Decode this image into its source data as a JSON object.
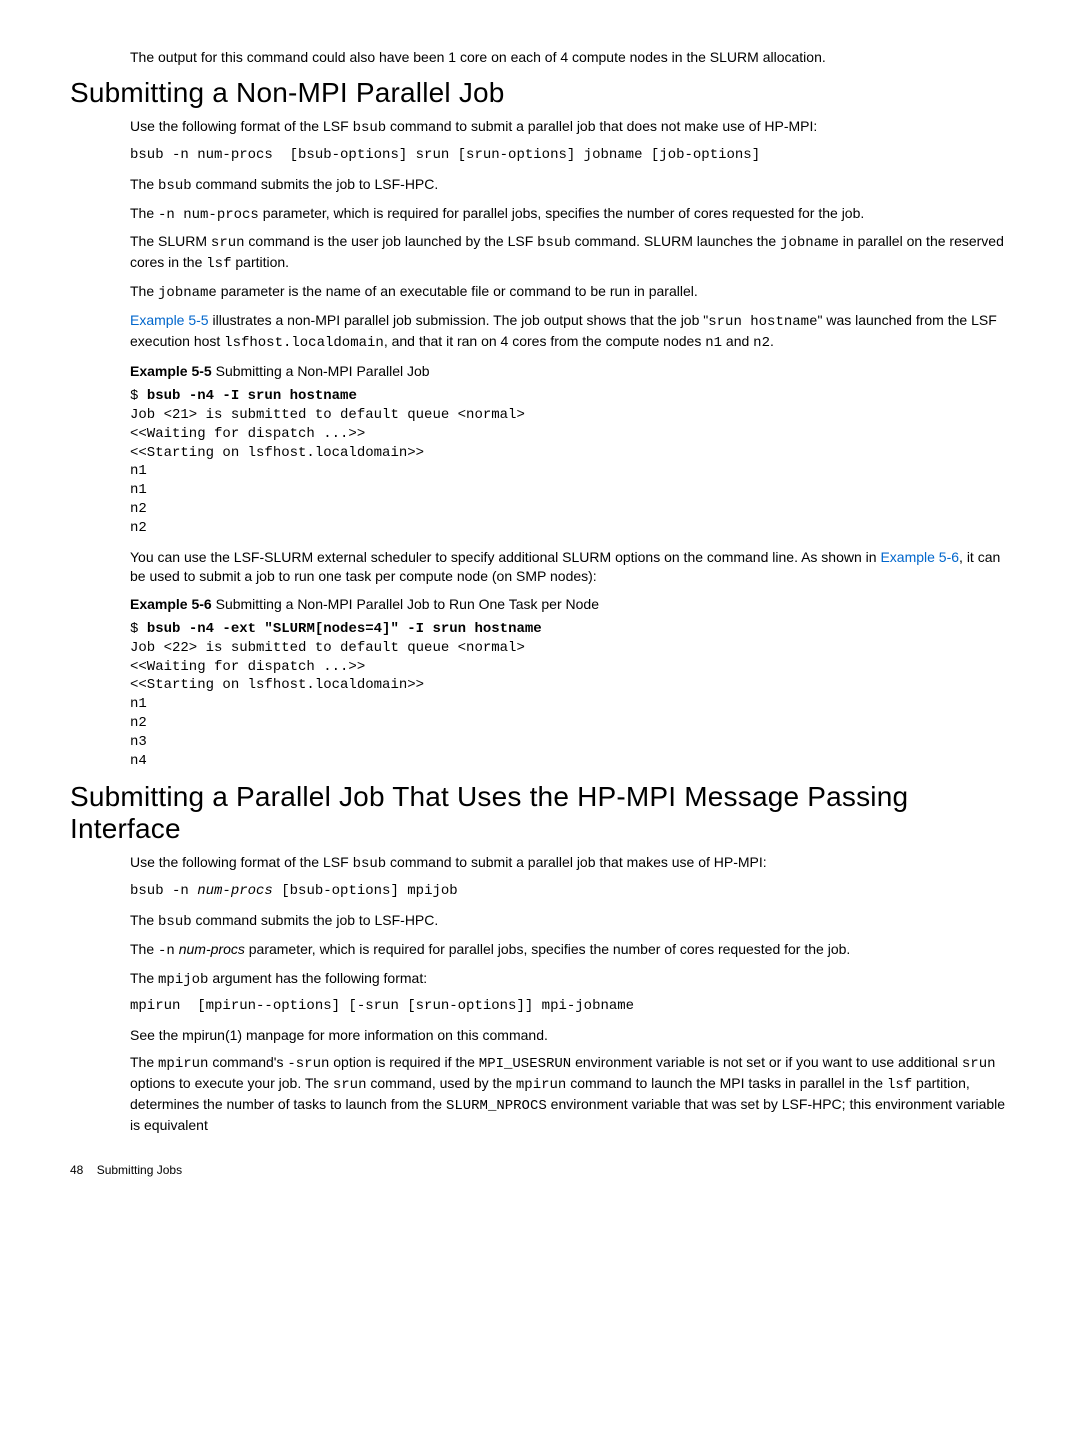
{
  "intro": "The output for this command could also have been 1 core on each of 4 compute nodes in the SLURM allocation.",
  "section1": {
    "heading": "Submitting a Non-MPI Parallel Job",
    "p1a": "Use the following format of the LSF ",
    "p1b": "bsub",
    "p1c": " command to submit a parallel job that does not make use of HP-MPI:",
    "cmd1": "bsub -n num-procs  [bsub-options] srun [srun-options] jobname [job-options]",
    "p2a": "The ",
    "p2b": "bsub",
    "p2c": " command submits the job to LSF-HPC.",
    "p3a": "The ",
    "p3b": "-n num-procs",
    "p3c": " parameter, which is required for parallel jobs, specifies the number of cores requested for the job.",
    "p4a": "The SLURM ",
    "p4b": "srun",
    "p4c": " command is the user job launched by the LSF ",
    "p4d": "bsub",
    "p4e": " command. SLURM launches the ",
    "p4f": "jobname",
    "p4g": " in parallel on the reserved cores in the ",
    "p4h": "lsf",
    "p4i": " partition.",
    "p5a": "The ",
    "p5b": "jobname",
    "p5c": " parameter is the name of an executable file or command to be run in parallel.",
    "p6a": "Example  5-5",
    "p6b": " illustrates a non-MPI parallel job submission. The job output shows that the job \"",
    "p6c": "srun hostname",
    "p6d": "\" was launched from the LSF execution host ",
    "p6e": "lsfhost.localdomain",
    "p6f": ", and that it ran on 4 cores from the compute nodes ",
    "p6g": "n1",
    "p6h": " and ",
    "p6i": "n2",
    "p6j": ".",
    "ex55label": "Example  5-5",
    "ex55title": "   Submitting a Non-MPI Parallel Job",
    "ex55prompt": "$ ",
    "ex55cmd": "bsub -n4 -I srun hostname",
    "ex55out": "Job <21> is submitted to default queue <normal>\n<<Waiting for dispatch ...>>\n<<Starting on lsfhost.localdomain>>\nn1\nn1\nn2\nn2",
    "p7a": "You can use the LSF-SLURM external scheduler to specify additional SLURM options on the command line. As shown in ",
    "p7b": "Example  5-6",
    "p7c": ", it can be used to submit a job to run one task per compute node (on SMP nodes):",
    "ex56label": "Example  5-6",
    "ex56title": "   Submitting a Non-MPI Parallel Job to Run One Task per Node",
    "ex56prompt": "$ ",
    "ex56cmd": "bsub -n4 -ext \"SLURM[nodes=4]\" -I srun hostname",
    "ex56out": "Job <22> is submitted to default queue <normal>\n<<Waiting for dispatch ...>>\n<<Starting on lsfhost.localdomain>>\nn1\nn2\nn3\nn4"
  },
  "section2": {
    "heading": "Submitting a Parallel Job That Uses the HP-MPI Message Passing Interface",
    "p1a": "Use the following format of the LSF ",
    "p1b": "bsub",
    "p1c": " command to submit a parallel job that makes use of HP-MPI:",
    "cmd1a": "bsub -n ",
    "cmd1b": "num-procs",
    "cmd1c": " [bsub-options] mpijob",
    "p2a": "The ",
    "p2b": "bsub",
    "p2c": " command submits the job to LSF-HPC.",
    "p3a": "The ",
    "p3b": "-n",
    "p3c": " ",
    "p3d": "num-procs",
    "p3e": " parameter, which is required for parallel jobs, specifies the number of cores requested for the job.",
    "p4a": "The ",
    "p4b": "mpijob",
    "p4c": " argument has the following format:",
    "cmd2": "mpirun  [mpirun--options] [-srun [srun-options]] mpi-jobname",
    "p5": "See the mpirun(1) manpage for more information on this command.",
    "p6a": "The ",
    "p6b": "mpirun",
    "p6c": " command's ",
    "p6d": "-srun",
    "p6e": " option is required if the ",
    "p6f": "MPI_USESRUN",
    "p6g": " environment variable is not set or if you want to use additional ",
    "p6h": "srun",
    "p6i": " options to execute your job. The ",
    "p6j": "srun",
    "p6k": " command, used by the ",
    "p6l": "mpirun",
    "p6m": " command to launch the MPI tasks in parallel in the ",
    "p6n": "lsf",
    "p6o": " partition, determines the number of tasks to launch from the ",
    "p6p": "SLURM_NPROCS",
    "p6q": " environment variable that was set by LSF-HPC; this environment variable is equivalent"
  },
  "footer": {
    "page": "48",
    "label": "Submitting Jobs"
  }
}
